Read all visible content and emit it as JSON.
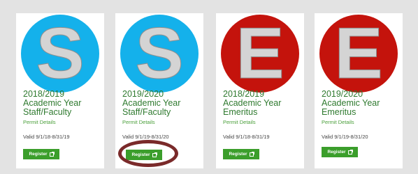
{
  "colors": {
    "staff_badge": "#14b1eb",
    "emeritus_badge": "#c4130c",
    "title_text": "#2f7a2f",
    "link_text": "#4ca03c",
    "button_bg": "#3b9e2b",
    "highlight_ring": "#7a2a2a"
  },
  "cards": [
    {
      "letter": "S",
      "title_line1": "2018/2019",
      "title_line2": "Academic Year",
      "title_line3": "Staff/Faculty",
      "details_label": "Permit Details",
      "valid_text": "Valid 9/1/18-8/31/19",
      "button_label": "Register",
      "button_icon": "external-link-icon"
    },
    {
      "letter": "S",
      "title_line1": "2019/2020",
      "title_line2": "Academic Year",
      "title_line3": "Staff/Faculty",
      "details_label": "Permit Details",
      "valid_text": "Valid 9/1/19-8/31/20",
      "button_label": "Register",
      "button_icon": "external-link-icon"
    },
    {
      "letter": "E",
      "title_line1": "2018/2019",
      "title_line2": "Academic Year",
      "title_line3": "Emeritus",
      "details_label": "Permit Details",
      "valid_text": "Valid 9/1/18-8/31/19",
      "button_label": "Register",
      "button_icon": "external-link-icon"
    },
    {
      "letter": "E",
      "title_line1": "2019/2020",
      "title_line2": "Academic Year",
      "title_line3": "Emeritus",
      "details_label": "Permit Details",
      "valid_text": "Valid 9/1/19-8/31/20",
      "button_label": "Register",
      "button_icon": "external-link-icon"
    }
  ]
}
